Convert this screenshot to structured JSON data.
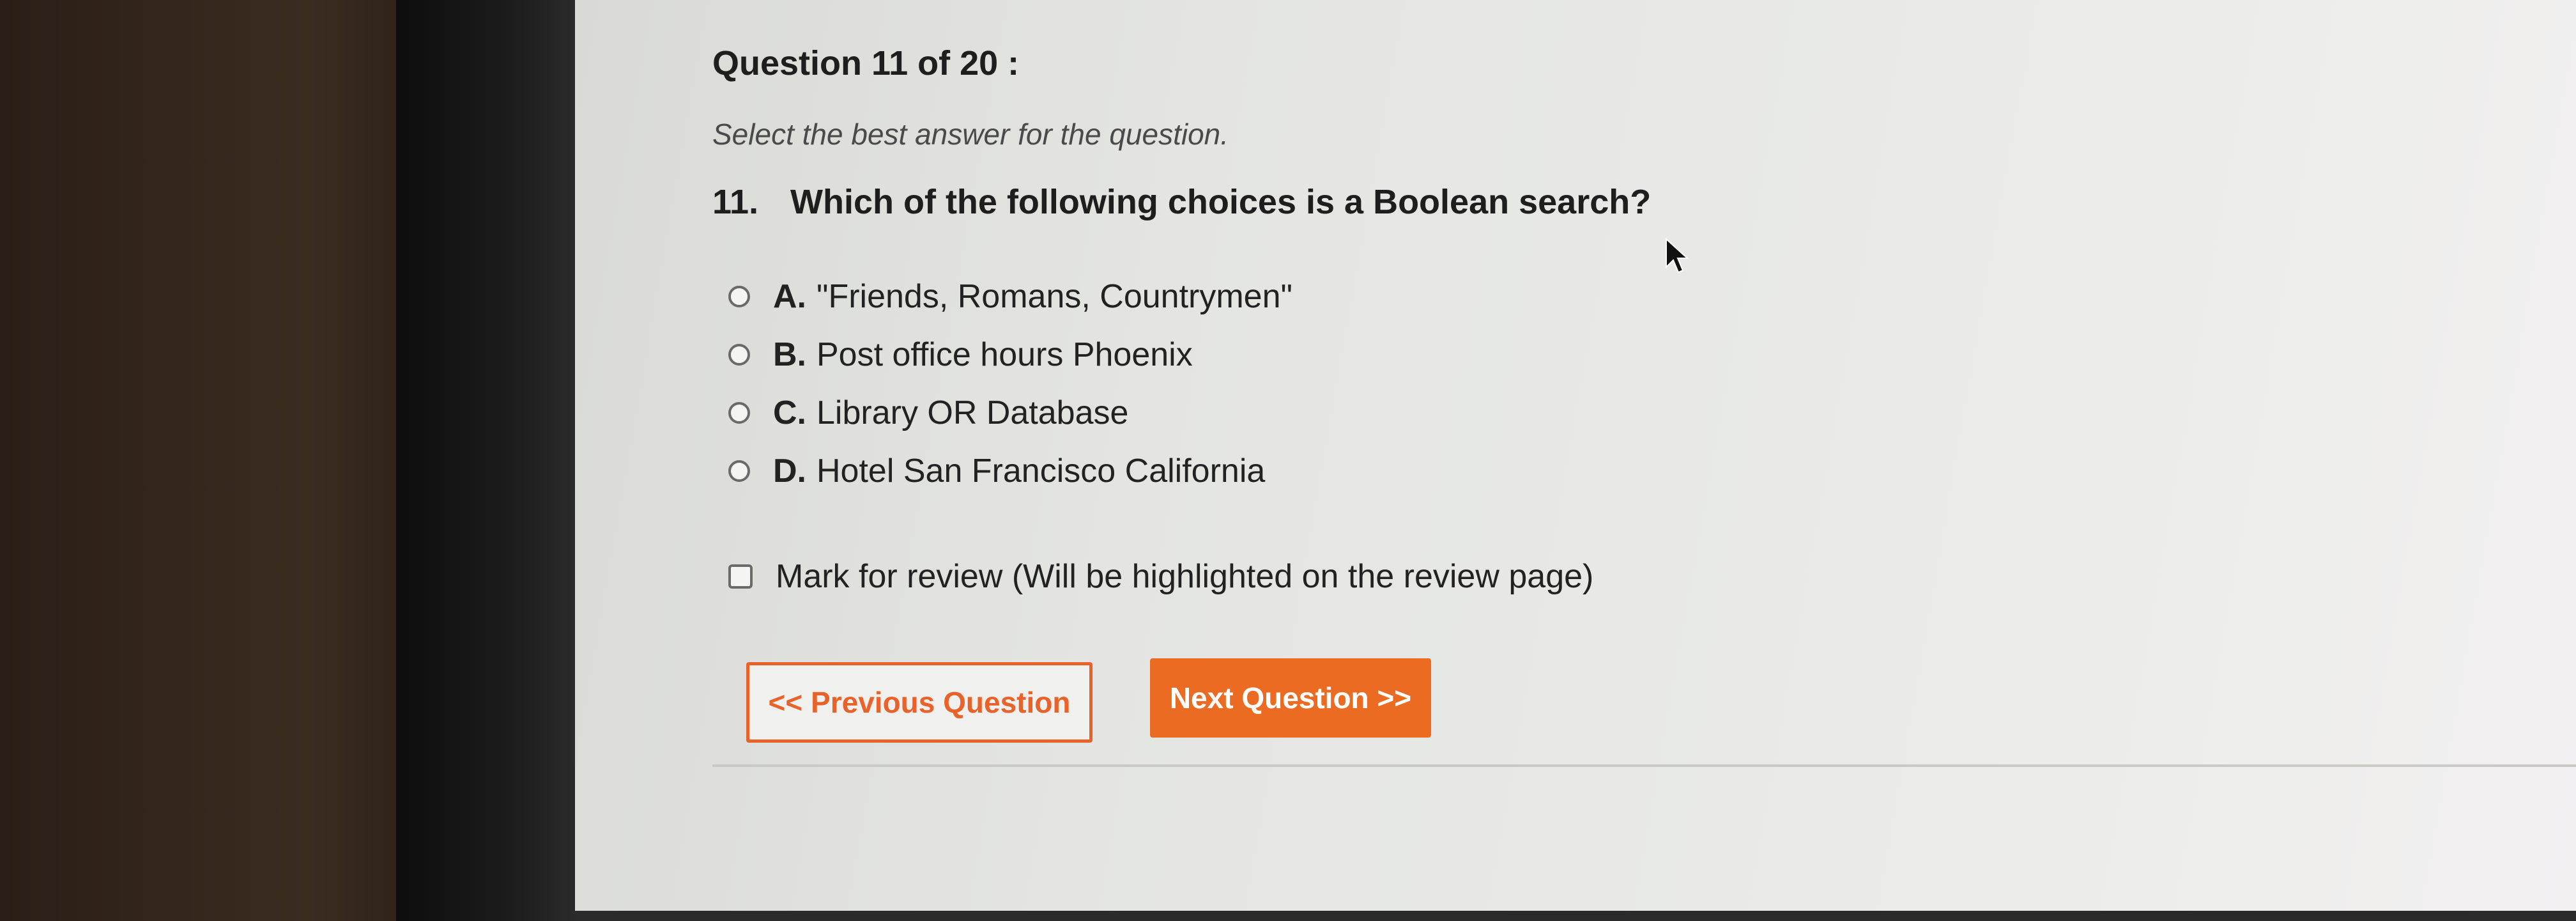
{
  "quiz": {
    "header": "Question 11 of 20 :",
    "instructions": "Select the best answer for the question.",
    "question_number": "11.",
    "question_text": "Which of the following choices is a Boolean search?",
    "options": [
      {
        "letter": "A.",
        "text": "\"Friends, Romans, Countrymen\""
      },
      {
        "letter": "B.",
        "text": "Post office hours Phoenix"
      },
      {
        "letter": "C.",
        "text": "Library OR Database"
      },
      {
        "letter": "D.",
        "text": "Hotel San Francisco California"
      }
    ],
    "review_label": "Mark for review (Will be highlighted on the review page)",
    "prev_button": "<< Previous Question",
    "next_button": "Next Question >>"
  },
  "colors": {
    "accent": "#ec6b22",
    "text": "#1e1e1e"
  },
  "icons": {
    "cursor": "mouse-pointer-icon"
  }
}
